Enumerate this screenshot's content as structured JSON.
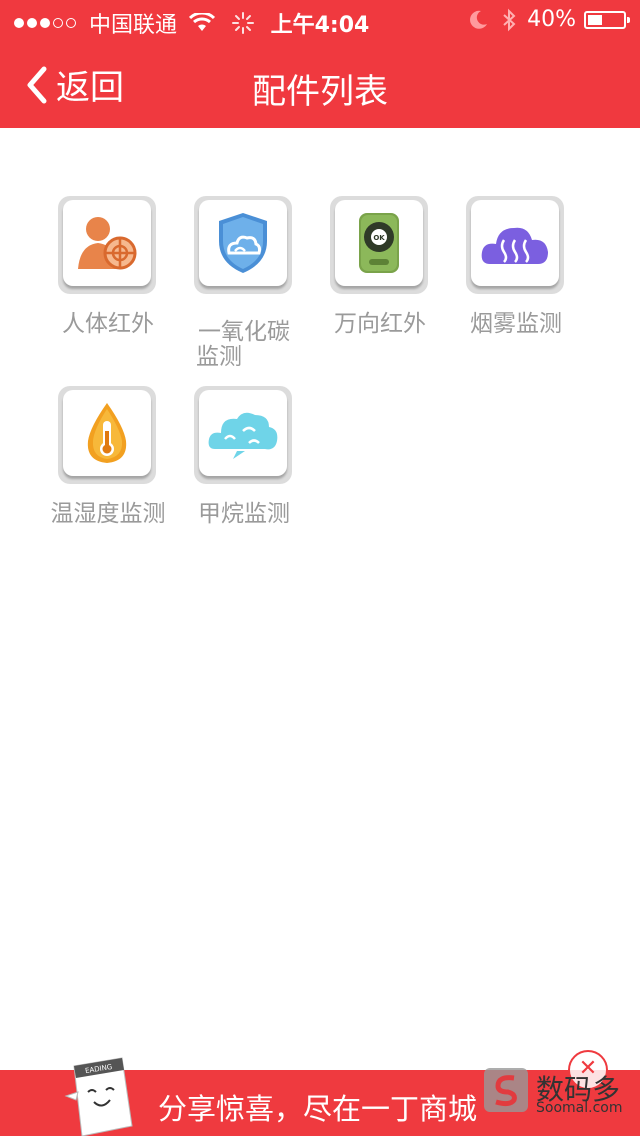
{
  "status": {
    "carrier": "中国联通",
    "time": "上午4:04",
    "battery": "40%",
    "battery_level": 0.4,
    "signal_bars": 3,
    "signal_total": 5
  },
  "nav": {
    "back_label": "返回",
    "title": "配件列表"
  },
  "accessories": [
    {
      "label_lines": [
        "人体红外"
      ],
      "icon": "human-infrared-icon"
    },
    {
      "label_lines": [
        "一氧化碳",
        "监测"
      ],
      "icon": "carbon-monoxide-icon"
    },
    {
      "label_lines": [
        "万向红外"
      ],
      "icon": "universal-remote-icon"
    },
    {
      "label_lines": [
        "烟雾监测"
      ],
      "icon": "smoke-cloud-icon"
    },
    {
      "label_lines": [
        "温湿度监测"
      ],
      "icon": "temperature-drop-icon"
    },
    {
      "label_lines": [
        "甲烷监测"
      ],
      "icon": "methane-cloud-icon"
    }
  ],
  "ad": {
    "text": "分享惊喜，尽在一丁商城",
    "mascot_badge": "EADING"
  },
  "watermark": {
    "text": "数码多",
    "sub": "Soomal.com"
  }
}
